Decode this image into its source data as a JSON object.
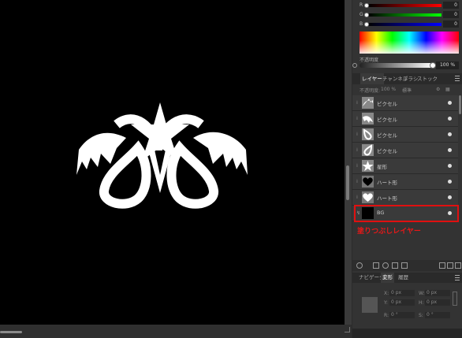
{
  "color": {
    "sliders": [
      {
        "label": "R",
        "value": "0",
        "gradient": "linear-gradient(to right,#000,#ff0000)"
      },
      {
        "label": "G",
        "value": "0",
        "gradient": "linear-gradient(to right,#000,#00ff00)"
      },
      {
        "label": "B",
        "value": "0",
        "gradient": "linear-gradient(to right,#000,#0000ff)"
      }
    ],
    "opacity_label": "不透明度",
    "opacity_value": "100 %"
  },
  "layers_panel": {
    "tabs": [
      "レイヤー",
      "チャンネル",
      "ブラシ",
      "ストック"
    ],
    "opacity_label": "不透明度:",
    "opacity_value": "100 %",
    "blend_mode": "標準",
    "layers": [
      {
        "name": "ピクセル",
        "thumb_icon": "pixel-shape-icon"
      },
      {
        "name": "ピクセル",
        "thumb_icon": "pixel-shape-icon"
      },
      {
        "name": "ピクセル",
        "thumb_icon": "drop-shape-icon"
      },
      {
        "name": "ピクセル",
        "thumb_icon": "drop-shape-icon"
      },
      {
        "name": "星形",
        "thumb_icon": "star-icon"
      },
      {
        "name": "ハート形",
        "thumb_icon": "heart-icon"
      },
      {
        "name": "ハート形",
        "thumb_icon": "heart-icon"
      },
      {
        "name": "BG",
        "thumb_icon": "bg-fill-icon"
      }
    ]
  },
  "annotation": "塗りつぶしレイヤー",
  "navigator": {
    "tabs": [
      "ナビゲータ",
      "変形",
      "履歴"
    ],
    "fields": [
      {
        "label": "X:",
        "value": "0 px"
      },
      {
        "label": "W:",
        "value": "0 px"
      },
      {
        "label": "Y:",
        "value": "0 px"
      },
      {
        "label": "H:",
        "value": "0 px"
      },
      {
        "label": "R:",
        "value": "0 °"
      },
      {
        "label": "S:",
        "value": "0 °"
      }
    ]
  },
  "colors": {
    "canvas_bg": "#000000",
    "highlight": "#e01010",
    "panel_bg": "#333333"
  }
}
